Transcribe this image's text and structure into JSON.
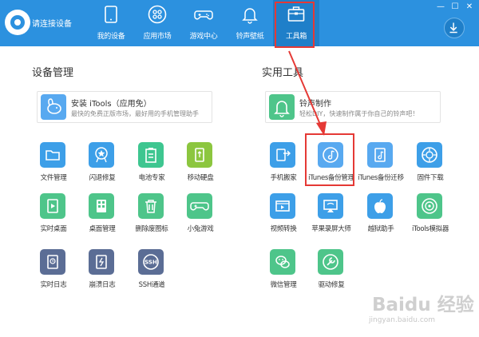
{
  "topbar": {
    "device_status": "请连接设备",
    "nav": [
      {
        "label": "我的设备",
        "icon": "tablet-icon"
      },
      {
        "label": "应用市场",
        "icon": "app-grid-icon"
      },
      {
        "label": "游戏中心",
        "icon": "gamepad-icon"
      },
      {
        "label": "铃声壁纸",
        "icon": "bell-icon"
      },
      {
        "label": "工具箱",
        "icon": "toolbox-icon",
        "active": true
      }
    ],
    "window_controls": [
      "—",
      "☐",
      "✕"
    ]
  },
  "device_management": {
    "title": "设备管理",
    "card": {
      "title": "安装 iTools（应用免）",
      "subtitle": "最快的免费正版市场，最好用的手机管理助手"
    },
    "tools": [
      {
        "label": "文件管理",
        "icon": "folder-icon"
      },
      {
        "label": "闪退修复",
        "icon": "star-badge-icon"
      },
      {
        "label": "电池专家",
        "icon": "battery-icon"
      },
      {
        "label": "移动硬盘",
        "icon": "usb-icon"
      },
      {
        "label": "实时桌面",
        "icon": "play-screen-icon"
      },
      {
        "label": "桌面管理",
        "icon": "grid-phone-icon"
      },
      {
        "label": "删除废图标",
        "icon": "trash-icon"
      },
      {
        "label": "小兔游戏",
        "icon": "gamepad-icon"
      },
      {
        "label": "实时日志",
        "icon": "clock-log-icon"
      },
      {
        "label": "崩溃日志",
        "icon": "crash-log-icon"
      },
      {
        "label": "SSH通道",
        "icon": "ssh-icon"
      }
    ]
  },
  "utilities": {
    "title": "实用工具",
    "card": {
      "title": "铃声制作",
      "subtitle": "轻松DIY，快速制作属于你自己的铃声吧！"
    },
    "tools": [
      {
        "label": "手机搬家",
        "icon": "phone-move-icon"
      },
      {
        "label": "iTunes备份管理",
        "icon": "music-backup-icon",
        "highlighted": true
      },
      {
        "label": "iTunes备份迁移",
        "icon": "music-file-icon"
      },
      {
        "label": "固件下载",
        "icon": "firmware-icon"
      },
      {
        "label": "视频转换",
        "icon": "video-icon"
      },
      {
        "label": "苹果录屏大师",
        "icon": "airplay-icon"
      },
      {
        "label": "越狱助手",
        "icon": "apple-icon"
      },
      {
        "label": "iTools模拟器",
        "icon": "emulator-icon"
      },
      {
        "label": "微信管理",
        "icon": "wechat-icon"
      },
      {
        "label": "驱动修复",
        "icon": "wrench-icon"
      }
    ]
  },
  "watermark": {
    "logo": "Baidu 经验",
    "sub": "jingyan.baidu.com"
  },
  "colors": {
    "topbar": "#2c91df",
    "accent_red": "#e53935"
  }
}
